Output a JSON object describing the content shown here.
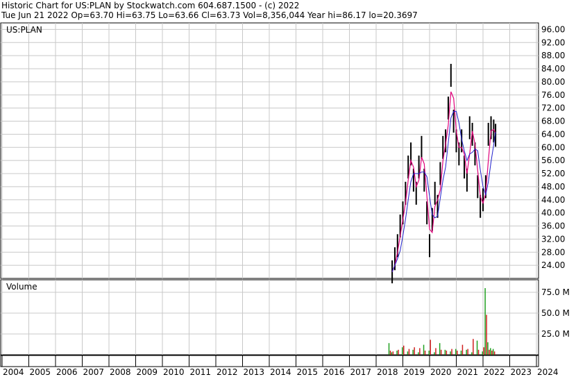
{
  "header": {
    "line1": "Historic Chart for US:PLAN by Stockwatch.com 604.687.1500 - (c) 2022",
    "line2": "Tue Jun 21 2022  Op=63.70  Hi=63.75  Lo=63.66  Cl=63.73  Vol=8,356,044  Year hi=86.17  lo=20.3697"
  },
  "chart_data": [
    {
      "type": "line",
      "title": "US:PLAN",
      "ylim": [
        20,
        98
      ],
      "yticks": [
        "96.00",
        "92.00",
        "88.00",
        "84.00",
        "80.00",
        "76.00",
        "72.00",
        "68.00",
        "64.00",
        "60.00",
        "56.00",
        "52.00",
        "48.00",
        "44.00",
        "40.00",
        "36.00",
        "32.00",
        "28.00",
        "24.00"
      ],
      "grid": true,
      "colors": {
        "price": "#000000",
        "ma_short": "#e0007a",
        "ma_long": "#2020cc",
        "grid": "#c8c8c8"
      },
      "series": [
        {
          "x": [
            2018.6,
            2018.7,
            2018.8,
            2018.9,
            2019.0,
            2019.1,
            2019.2,
            2019.3,
            2019.4,
            2019.5,
            2019.6,
            2019.7,
            2019.8,
            2019.9,
            2020.0,
            2020.1,
            2020.2,
            2020.3,
            2020.4,
            2020.5,
            2020.6,
            2020.7,
            2020.8,
            2020.9,
            2021.0,
            2021.1,
            2021.2,
            2021.3,
            2021.4,
            2021.5,
            2021.6,
            2021.7,
            2021.8,
            2021.9,
            2022.0,
            2022.1,
            2022.2,
            2022.3,
            2022.4,
            2022.47
          ],
          "values": [
            22,
            26,
            30,
            36,
            40,
            46,
            54,
            58,
            50,
            46,
            54,
            60,
            50,
            40,
            30,
            38,
            46,
            42,
            52,
            60,
            62,
            72,
            82,
            68,
            62,
            58,
            62,
            54,
            50,
            66,
            64,
            58,
            48,
            42,
            44,
            48,
            64,
            66,
            65,
            63.7
          ]
        }
      ]
    },
    {
      "type": "bar",
      "title": "Volume",
      "ylim": [
        0,
        90
      ],
      "yticks": [
        "75.0 M",
        "50.0 M",
        "25.0 M"
      ],
      "x": [
        2018.5,
        2018.6,
        2018.8,
        2019.0,
        2019.2,
        2019.4,
        2019.6,
        2019.8,
        2020.0,
        2020.2,
        2020.4,
        2020.6,
        2020.8,
        2021.0,
        2021.2,
        2021.4,
        2021.6,
        2021.8,
        2022.0,
        2022.1,
        2022.2,
        2022.3,
        2022.4
      ],
      "series": [
        {
          "name": "up",
          "values": [
            14,
            3,
            5,
            9,
            4,
            6,
            3,
            12,
            5,
            3,
            14,
            6,
            4,
            7,
            5,
            6,
            3,
            17,
            4,
            80,
            15,
            8,
            7
          ]
        },
        {
          "name": "down",
          "values": [
            5,
            4,
            6,
            11,
            7,
            9,
            8,
            5,
            18,
            8,
            6,
            5,
            7,
            5,
            12,
            7,
            19,
            6,
            9,
            48,
            6,
            5,
            4
          ]
        }
      ],
      "years": [
        "2004",
        "2005",
        "2006",
        "2007",
        "2008",
        "2009",
        "2010",
        "2011",
        "2012",
        "2013",
        "2014",
        "2015",
        "2016",
        "2017",
        "2018",
        "2019",
        "2020",
        "2021",
        "2022",
        "2023",
        "2024"
      ]
    }
  ]
}
